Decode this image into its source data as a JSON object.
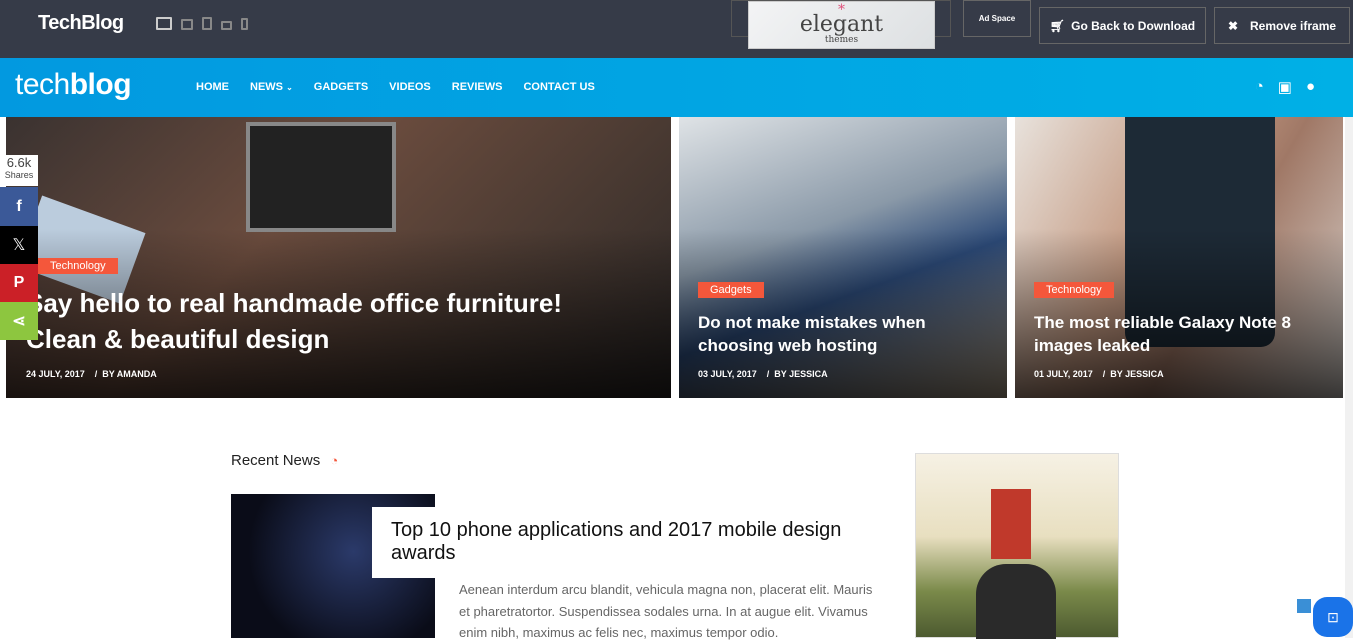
{
  "topbar": {
    "brand": "TechBlog",
    "ad_logo": "elegant",
    "ad_logo_sub": "themes",
    "ad_space": "Ad Space",
    "go_back": "Go Back to Download",
    "remove_iframe": "Remove iframe"
  },
  "nav": {
    "logo_light": "tech",
    "logo_bold": "blog",
    "items": [
      "HOME",
      "NEWS",
      "GADGETS",
      "VIDEOS",
      "REVIEWS",
      "CONTACT US"
    ]
  },
  "share": {
    "count": "6.6k",
    "label": "Shares"
  },
  "featured": [
    {
      "tag": "Technology",
      "title": "Say hello to real handmade office furniture! Clean & beautiful design",
      "date": "24 JULY, 2017",
      "author": "BY AMANDA"
    },
    {
      "tag": "Gadgets",
      "title": "Do not make mistakes when choosing web hosting",
      "date": "03 JULY, 2017",
      "author": "BY JESSICA"
    },
    {
      "tag": "Technology",
      "title": "The most reliable Galaxy Note 8 images leaked",
      "date": "01 JULY, 2017",
      "author": "BY JESSICA"
    }
  ],
  "recent": {
    "heading": "Recent News",
    "post": {
      "title": "Top 10 phone applications and 2017 mobile design awards",
      "excerpt": "Aenean interdum arcu blandit, vehicula magna non, placerat elit. Mauris et pharetratortor. Suspendissea sodales urna. In at augue elit. Vivamus enim nibh, maximus ac felis nec, maximus tempor odio."
    }
  },
  "colors": {
    "topbar": "#363b48",
    "nav": "#02a3e3",
    "tag": "#f4573b",
    "facebook": "#3b5998",
    "x": "#000000",
    "pinterest": "#cb2027",
    "share": "#8dc63f"
  }
}
